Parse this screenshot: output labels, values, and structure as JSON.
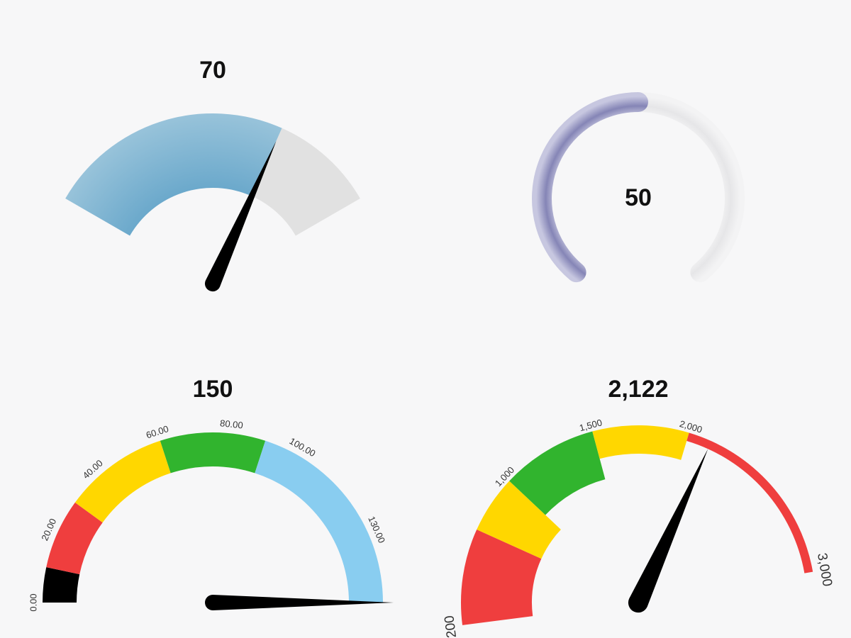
{
  "chart_data": [
    {
      "type": "gauge",
      "id": "gauge-1",
      "value": 70,
      "value_label": "70",
      "min": 0,
      "max": 100,
      "angle_range": [
        -60,
        60
      ],
      "colors": {
        "fill": "#7fb3d3",
        "remainder": "#e1e1e1",
        "needle": "#000000"
      }
    },
    {
      "type": "gauge",
      "id": "gauge-2",
      "value": 50,
      "value_label": "50",
      "min": 0,
      "max": 100,
      "angle_range": [
        -140,
        140
      ],
      "colors": {
        "fill": "#8f8fbd",
        "remainder": "#ececee"
      }
    },
    {
      "type": "gauge",
      "id": "gauge-3",
      "value": 150,
      "value_label": "150",
      "min": 0,
      "max": 150,
      "angle_range": [
        -90,
        90
      ],
      "bands": [
        {
          "from": 0,
          "to": 10,
          "color": "#000000"
        },
        {
          "from": 10,
          "to": 30,
          "color": "#ef3e3e"
        },
        {
          "from": 30,
          "to": 60,
          "color": "#ffd700"
        },
        {
          "from": 60,
          "to": 90,
          "color": "#31b42e"
        },
        {
          "from": 90,
          "to": 150,
          "color": "#89cdf0"
        }
      ],
      "ticks": [
        {
          "value": 0,
          "label": "0.00"
        },
        {
          "value": 20,
          "label": "20.00"
        },
        {
          "value": 40,
          "label": "40.00"
        },
        {
          "value": 60,
          "label": "60.00"
        },
        {
          "value": 80,
          "label": "80.00"
        },
        {
          "value": 100,
          "label": "100.00"
        },
        {
          "value": 130,
          "label": "130.00"
        }
      ],
      "needle_color": "#000000"
    },
    {
      "type": "gauge",
      "id": "gauge-4",
      "value": 2122,
      "value_label": "2,122",
      "min": 0,
      "max": 3000,
      "angle_range": [
        -110,
        80
      ],
      "bands": [
        {
          "from": 200,
          "to": 700,
          "color": "#ef3e3e",
          "width": "wide"
        },
        {
          "from": 700,
          "to": 1000,
          "color": "#ffd700",
          "width": "wide"
        },
        {
          "from": 1000,
          "to": 1500,
          "color": "#31b42e",
          "width": "medium"
        },
        {
          "from": 1500,
          "to": 2000,
          "color": "#ffd700",
          "width": "narrow"
        },
        {
          "from": 2000,
          "to": 3000,
          "color": "#ef3e3e",
          "width": "thin"
        }
      ],
      "ticks": [
        {
          "value": 200,
          "label": "200",
          "size": "large"
        },
        {
          "value": 1000,
          "label": "1,000",
          "size": "small"
        },
        {
          "value": 1500,
          "label": "1,500",
          "size": "small"
        },
        {
          "value": 2000,
          "label": "2,000",
          "size": "small"
        },
        {
          "value": 3000,
          "label": "3,000",
          "size": "large"
        }
      ],
      "needle_color": "#000000"
    }
  ]
}
